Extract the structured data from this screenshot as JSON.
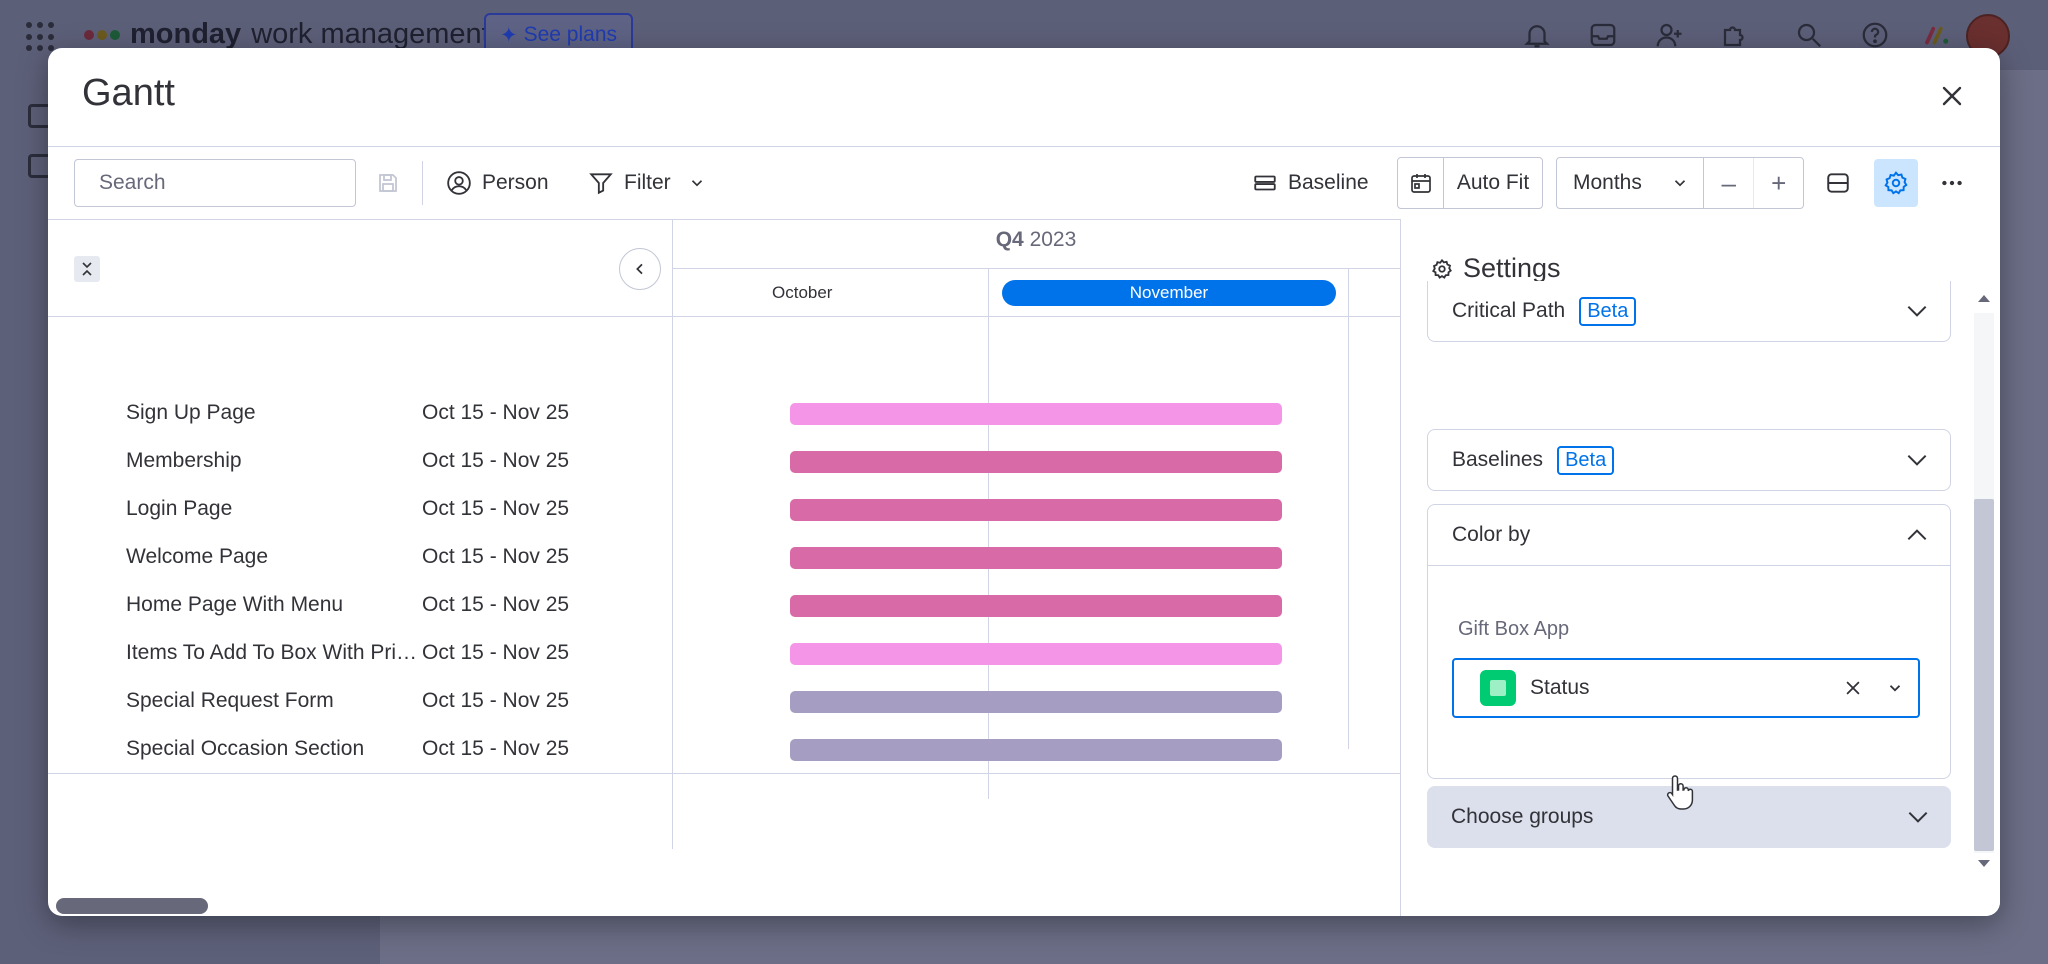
{
  "background": {
    "brand": "monday",
    "brand_suffix": "work management",
    "see_plans": "See plans"
  },
  "modal": {
    "title": "Gantt"
  },
  "toolbar": {
    "search_placeholder": "Search",
    "person_label": "Person",
    "filter_label": "Filter",
    "baseline_label": "Baseline",
    "autofit_label": "Auto Fit",
    "months_label": "Months",
    "zoom_out": "–",
    "zoom_in": "+"
  },
  "timeline": {
    "quarter": "Q4",
    "year": "2023",
    "months": [
      "October",
      "November"
    ],
    "active_month": "November"
  },
  "tasks": [
    {
      "name": "Sign Up Page",
      "dates": "Oct 15 - Nov 25",
      "color": "#f495e8"
    },
    {
      "name": "Membership",
      "dates": "Oct 15 - Nov 25",
      "color": "#d96aa8"
    },
    {
      "name": "Login Page",
      "dates": "Oct 15 - Nov 25",
      "color": "#d96aa8"
    },
    {
      "name": "Welcome Page",
      "dates": "Oct 15 - Nov 25",
      "color": "#d96aa8"
    },
    {
      "name": "Home Page With Menu",
      "dates": "Oct 15 - Nov 25",
      "color": "#d96aa8"
    },
    {
      "name": "Items To Add To Box With Pric...",
      "dates": "Oct 15 - Nov 25",
      "color": "#f495e8"
    },
    {
      "name": "Special Request Form",
      "dates": "Oct 15 - Nov 25",
      "color": "#a69dc2"
    },
    {
      "name": "Special Occasion Section",
      "dates": "Oct 15 - Nov 25",
      "color": "#a69dc2"
    }
  ],
  "settings": {
    "title": "Settings",
    "critical_path": "Critical Path",
    "baselines": "Baselines",
    "beta": "Beta",
    "color_by": "Color by",
    "board_name": "Gift Box App",
    "color_column": "Status",
    "choose_groups": "Choose groups"
  },
  "colors": {
    "accent": "#0073ea",
    "status_green": "#00ca72"
  }
}
